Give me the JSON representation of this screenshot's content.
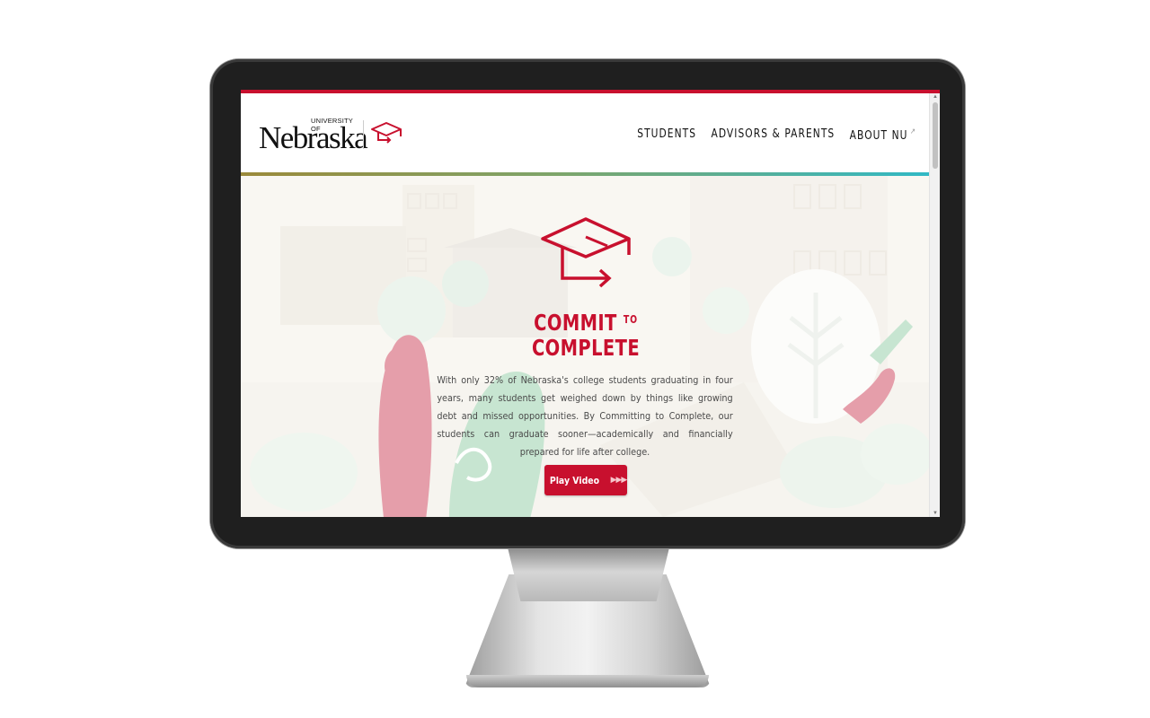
{
  "brand": {
    "logo_main": "Nebraska",
    "logo_small": "UNIVERSITY OF"
  },
  "nav": {
    "items": [
      {
        "label": "STUDENTS"
      },
      {
        "label": "ADVISORS & PARENTS"
      },
      {
        "label": "ABOUT NU"
      }
    ],
    "external_icon": "external-link-icon"
  },
  "hero": {
    "title_line1": "COMMIT",
    "title_to": "TO",
    "title_line2": "COMPLETE",
    "body": "With only 32% of Nebraska's college students graduating in four years, many students get weighed down by things like growing debt and missed opportunities. By Committing to Complete, our students can graduate sooner—academically and financially prepared for life after college.",
    "button_label": "Play Video",
    "button_icon": "play-arrows-icon"
  },
  "colors": {
    "accent": "#c8102e",
    "header_gradient_start": "#9b8a3a",
    "header_gradient_end": "#2fb9c7"
  }
}
